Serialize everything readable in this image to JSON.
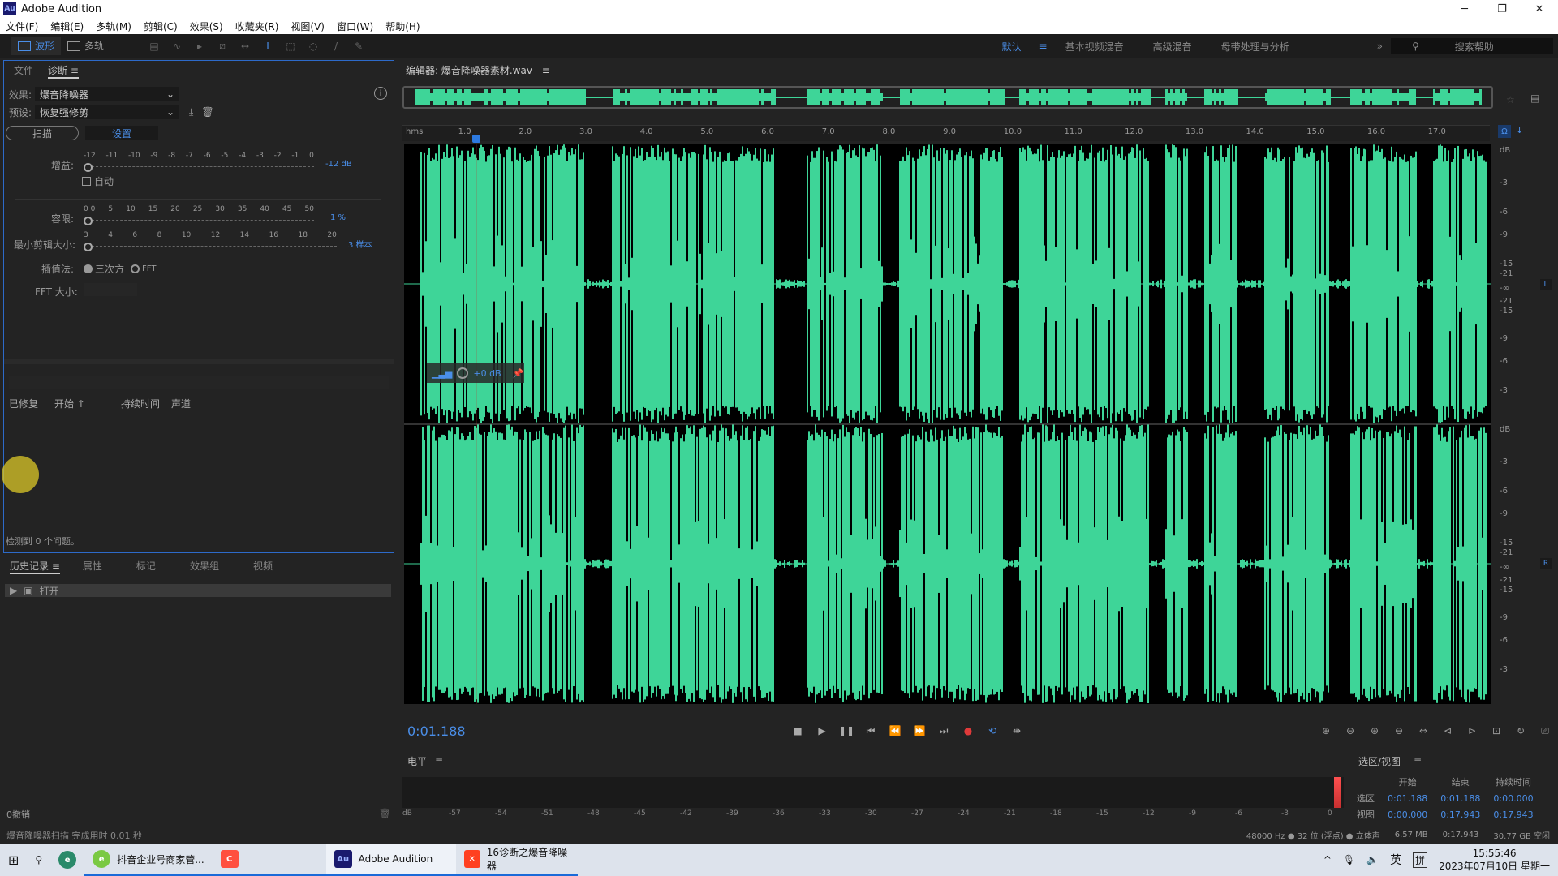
{
  "app": {
    "title": "Adobe Audition",
    "logo": "Au"
  },
  "window_controls": [
    "minimize",
    "restore",
    "close"
  ],
  "menu": [
    "文件(F)",
    "编辑(E)",
    "多轨(M)",
    "剪辑(C)",
    "效果(S)",
    "收藏夹(R)",
    "视图(V)",
    "窗口(W)",
    "帮助(H)"
  ],
  "toolbar": {
    "waveform_label": "波形",
    "multitrack_label": "多轨"
  },
  "workspaces": {
    "items": [
      "默认",
      "基本视频混音",
      "高级混音",
      "母带处理与分析"
    ],
    "active": "默认",
    "search_placeholder": "搜索帮助"
  },
  "left_panel": {
    "tabs": [
      "文件",
      "诊断"
    ],
    "active_tab": "诊断",
    "effect_label": "效果:",
    "effect_value": "爆音降噪器",
    "preset_label": "预设:",
    "preset_value": "恢复强修剪",
    "scan_button": "扫描",
    "settings_button": "设置",
    "gain": {
      "label": "增益:",
      "ticks": [
        "-12",
        "-11",
        "-10",
        "-9",
        "-8",
        "-7",
        "-6",
        "-5",
        "-4",
        "-3",
        "-2",
        "-1",
        "0"
      ],
      "value_text": "-12 dB",
      "value": -12
    },
    "auto_label": "自动",
    "auto_checked": false,
    "tolerance": {
      "label": "容限:",
      "ticks": [
        "0 0",
        "5",
        "10",
        "15",
        "20",
        "25",
        "30",
        "35",
        "40",
        "45",
        "50"
      ],
      "value_text": "1 %",
      "value": 1
    },
    "min_clip": {
      "label": "最小剪辑大小:",
      "ticks": [
        "3",
        "4",
        "6",
        "8",
        "10",
        "12",
        "14",
        "16",
        "18",
        "20"
      ],
      "value_text": "3 样本",
      "value": 3
    },
    "interp": {
      "label": "插值法:",
      "options": [
        "三次方",
        "FFT"
      ],
      "selected": "三次方"
    },
    "fft_label": "FFT 大小:",
    "list_headers": [
      "已修复",
      "开始 ↑",
      "持续时间",
      "声道"
    ],
    "detected_text": "检测到 0 个问题。"
  },
  "history_panel": {
    "tabs": [
      "历史记录",
      "属性",
      "标记",
      "效果组",
      "视频"
    ],
    "active_tab": "历史记录",
    "items": [
      {
        "label": "打开"
      }
    ],
    "undo_text": "0撤销"
  },
  "status_left": "爆音降噪器扫描 完成用时 0.01 秒",
  "editor": {
    "title": "编辑器: 爆音降噪器素材.wav",
    "ruler_unit": "hms",
    "ruler_ticks": [
      "1.0",
      "2.0",
      "3.0",
      "4.0",
      "5.0",
      "6.0",
      "7.0",
      "8.0",
      "9.0",
      "10.0",
      "11.0",
      "12.0",
      "13.0",
      "14.0",
      "15.0",
      "16.0",
      "17.0"
    ],
    "db_scale_top": [
      "dB",
      "-3",
      "-6",
      "-9",
      "-15",
      "-21",
      "-∞",
      "-21",
      "-15",
      "-9",
      "-6",
      "-3"
    ],
    "db_scale_bottom": [
      "dB",
      "-3",
      "-6",
      "-9",
      "-15",
      "-21",
      "-∞",
      "-21",
      "-15",
      "-9",
      "-6",
      "-3"
    ],
    "channels": [
      "L",
      "R"
    ],
    "hud_gain": "+0 dB",
    "waveform_color": "#3ed598",
    "playhead_seconds": 1.188,
    "duration_seconds": 17.943
  },
  "transport": {
    "current_time": "0:01.188"
  },
  "level_meter": {
    "title": "电平",
    "scale": [
      "dB",
      "-57",
      "-54",
      "-51",
      "-48",
      "-45",
      "-42",
      "-39",
      "-36",
      "-33",
      "-30",
      "-27",
      "-24",
      "-21",
      "-18",
      "-15",
      "-12",
      "-9",
      "-6",
      "-3",
      "0"
    ]
  },
  "selection_view": {
    "title": "选区/视图",
    "columns": [
      "开始",
      "结束",
      "持续时间"
    ],
    "rows": [
      {
        "label": "选区",
        "start": "0:01.188",
        "end": "0:01.188",
        "duration": "0:00.000"
      },
      {
        "label": "视图",
        "start": "0:00.000",
        "end": "0:17.943",
        "duration": "0:17.943"
      }
    ]
  },
  "statusbar": {
    "sample_info": "48000 Hz ● 32 位 (浮点) ● 立体声",
    "size": "6.57 MB",
    "duration": "0:17.943",
    "free": "30.77 GB 空闲"
  },
  "taskbar": {
    "items": [
      {
        "label": "抖音企业号商家管..."
      },
      {
        "label": ""
      },
      {
        "label": "Adobe Audition",
        "active": true
      },
      {
        "label": "16诊断之爆音降噪器"
      }
    ],
    "tray": {
      "ime1": "英",
      "ime2": "拼",
      "time": "15:55:46",
      "date": "2023年07月10日 星期一"
    }
  }
}
